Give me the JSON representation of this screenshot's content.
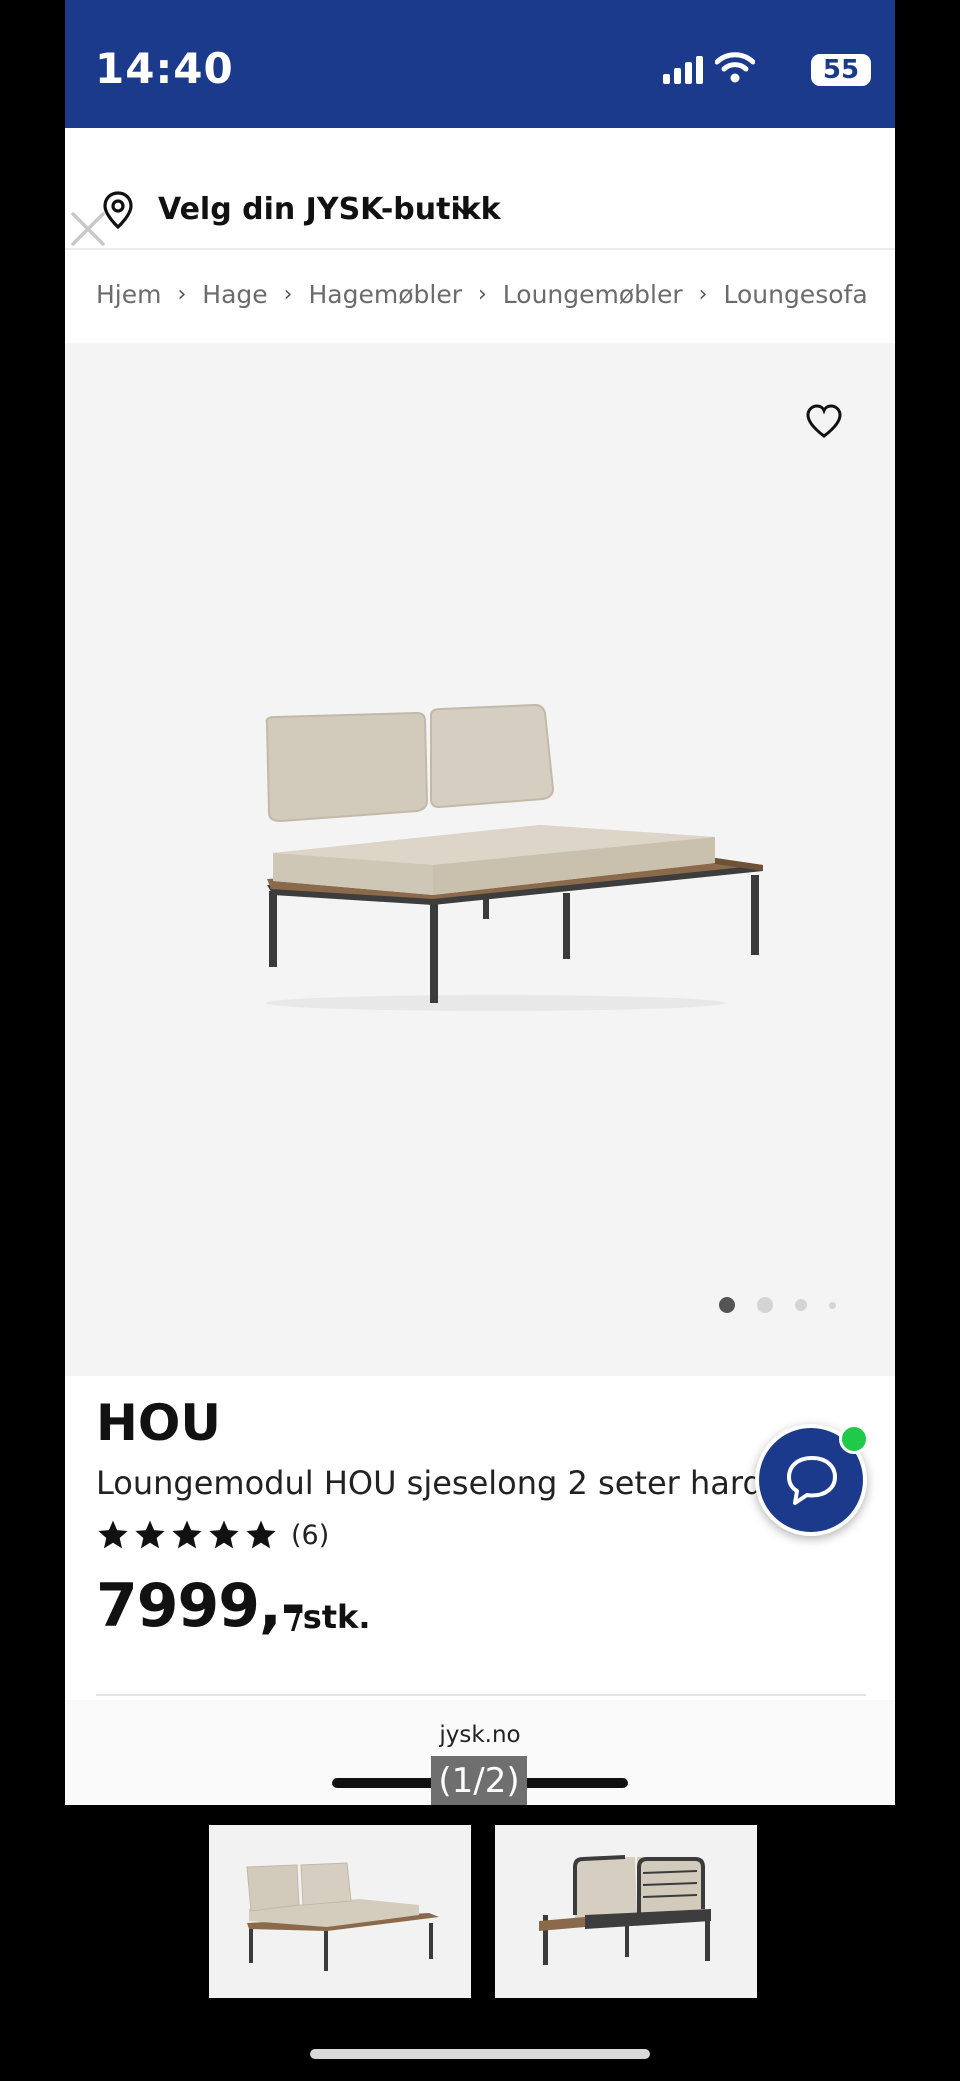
{
  "status_bar": {
    "time": "14:40",
    "battery": "55",
    "background_color": "#1b3a8c"
  },
  "store_selector": {
    "label": "Velg din JYSK-butikk",
    "icon": "location-pin-icon",
    "dropdown_icon": "chevron-down-icon"
  },
  "breadcrumb": {
    "items": [
      "Hjem",
      "Hage",
      "Hagemøbler",
      "Loungemøbler",
      "Loungesofa"
    ]
  },
  "gallery": {
    "favorite_icon": "heart-outline-icon",
    "current_image": 1,
    "dot_count": 4
  },
  "product": {
    "brand": "HOU",
    "description": "Loungemodul HOU sjeselong 2 seter hardtre",
    "rating": 5,
    "rating_count": "(6)",
    "price": "7999,-",
    "unit": "/stk."
  },
  "chat": {
    "icon": "chat-bubble-icon",
    "online_color": "#1fc94a"
  },
  "browser_footer": {
    "domain": "jysk.no",
    "page_indicator": "(1/2)"
  },
  "thumbnails": [
    {
      "icon": "lounge-sofa-front-thumbnail"
    },
    {
      "icon": "lounge-sofa-back-thumbnail"
    }
  ]
}
